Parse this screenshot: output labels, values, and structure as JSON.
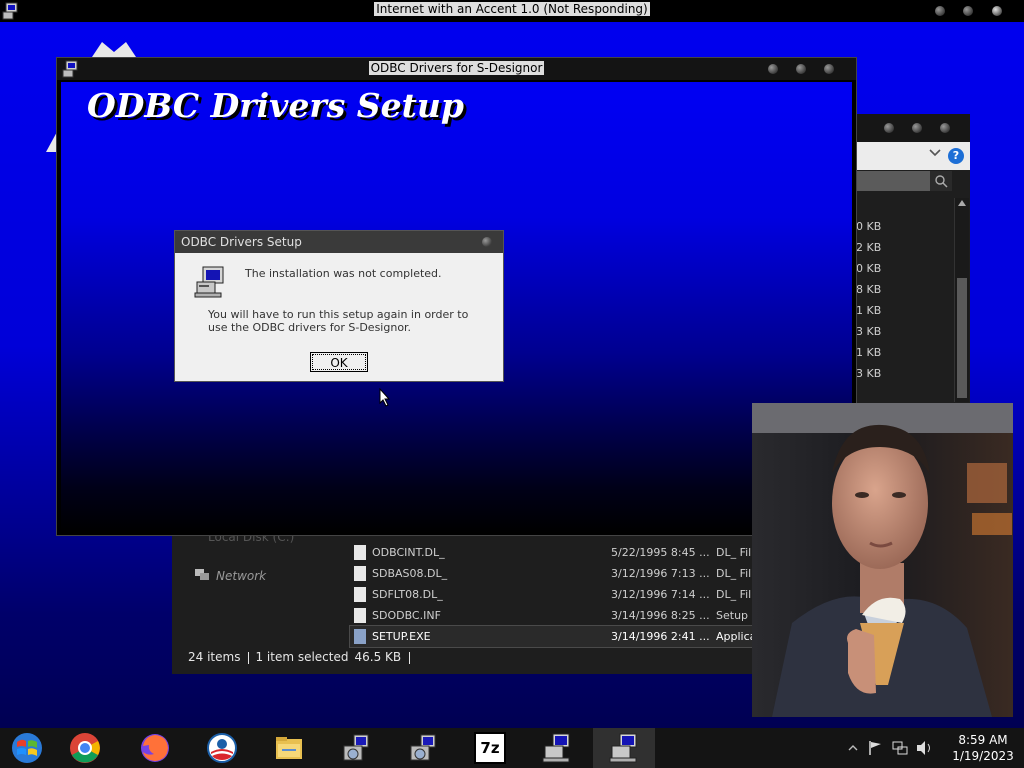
{
  "top_window": {
    "title": "Internet with an Accent 1.0 (Not Responding)"
  },
  "setup_window": {
    "title": "ODBC Drivers for S-Designor",
    "heading": "ODBC Drivers Setup"
  },
  "dialog": {
    "title": "ODBC Drivers Setup",
    "message_line1": "The installation was not completed.",
    "message_line2": "You will have to run this setup again in order to use the ODBC drivers for S-Designor.",
    "ok_label": "OK"
  },
  "explorer": {
    "sidebar_drive_partial": "Local Disk (C:)",
    "sidebar_network": "Network",
    "size_column": [
      "0 KB",
      "2 KB",
      "0 KB",
      "8 KB",
      "1 KB",
      "3 KB",
      "1 KB",
      "3 KB"
    ],
    "files": [
      {
        "name": "ODBCINT.DL_",
        "date": "5/22/1995 8:45 ...",
        "type": "DL_ Fil"
      },
      {
        "name": "SDBAS08.DL_",
        "date": "3/12/1996 7:13 ...",
        "type": "DL_ Fil"
      },
      {
        "name": "SDFLT08.DL_",
        "date": "3/12/1996 7:14 ...",
        "type": "DL_ Fil"
      },
      {
        "name": "SDODBC.INF",
        "date": "3/14/1996 8:25 ...",
        "type": "Setup I"
      },
      {
        "name": "SETUP.EXE",
        "date": "3/14/1996 2:41 ...",
        "type": "Applica"
      }
    ],
    "status": {
      "items": "24 items",
      "selected": "1 item selected",
      "size": "46.5 KB"
    }
  },
  "taskbar": {
    "items": [
      {
        "icon": "windows-start-icon"
      },
      {
        "icon": "chrome-icon"
      },
      {
        "icon": "firefox-icon"
      },
      {
        "icon": "obama-logo-icon"
      },
      {
        "icon": "file-explorer-icon"
      },
      {
        "icon": "setup-installer-icon"
      },
      {
        "icon": "setup-installer-icon"
      },
      {
        "icon": "7zip-icon",
        "label": "7z"
      },
      {
        "icon": "computer-setup-icon"
      },
      {
        "icon": "computer-setup-icon"
      }
    ],
    "time": "8:59 AM",
    "date": "1/19/2023"
  },
  "colors": {
    "desktop_blue": "#0000e0",
    "dialog_bg": "#f0f0f0",
    "help_blue": "#1d6fd6"
  }
}
